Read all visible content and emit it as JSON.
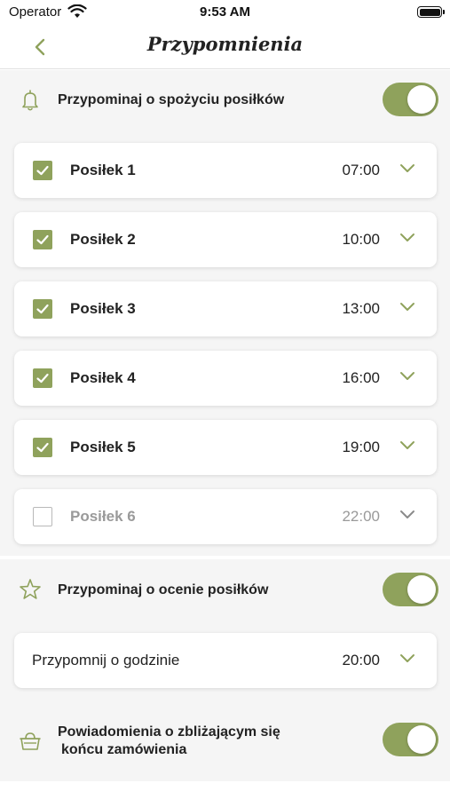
{
  "status_bar": {
    "carrier": "Operator",
    "time": "9:53 AM"
  },
  "nav": {
    "title": "Przypomnienia"
  },
  "meal_reminder": {
    "label": "Przypominaj o spożyciu posiłków",
    "toggle_on": true,
    "meals": [
      {
        "name": "Posiłek 1",
        "time": "07:00",
        "checked": true
      },
      {
        "name": "Posiłek 2",
        "time": "10:00",
        "checked": true
      },
      {
        "name": "Posiłek 3",
        "time": "13:00",
        "checked": true
      },
      {
        "name": "Posiłek 4",
        "time": "16:00",
        "checked": true
      },
      {
        "name": "Posiłek 5",
        "time": "19:00",
        "checked": true
      },
      {
        "name": "Posiłek 6",
        "time": "22:00",
        "checked": false
      }
    ]
  },
  "rating_reminder": {
    "label": "Przypominaj o ocenie posiłków",
    "toggle_on": true,
    "time_label": "Przypomnij o godzinie",
    "time": "20:00"
  },
  "order_end": {
    "label_line1": "Powiadomienia o zbliżającym się",
    "label_line2": "końcu zamówienia",
    "toggle_on": true
  },
  "colors": {
    "accent": "#8fa25c",
    "section_bg": "#f5f5f5",
    "disabled_text": "#9a9a9a"
  },
  "icons": {
    "back": "chevron-left-icon",
    "bell": "bell-icon",
    "star": "star-icon",
    "basket": "basket-icon",
    "expand": "chevron-down-icon",
    "check": "checkmark-icon",
    "wifi": "wifi-icon",
    "battery": "battery-icon"
  }
}
